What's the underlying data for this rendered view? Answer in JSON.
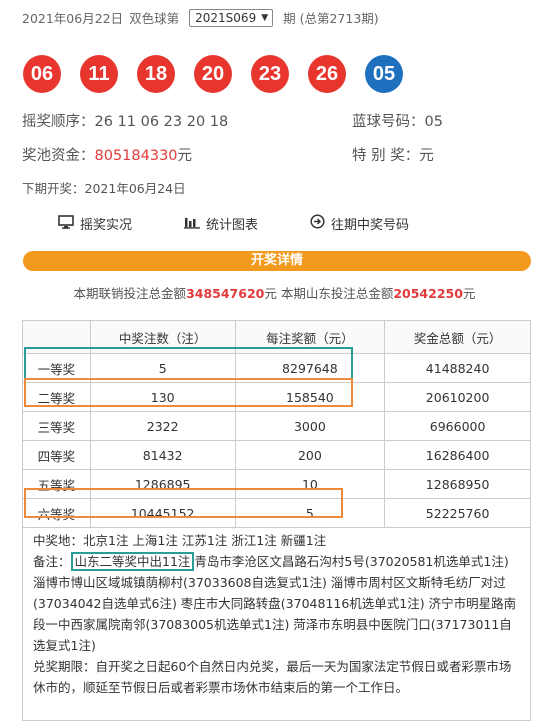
{
  "header": {
    "date": "2021年06月22日",
    "game": "双色球第",
    "issue_value": "2021S069",
    "suffix": "期 (总第2713期)"
  },
  "balls": [
    {
      "num": "06",
      "color": "#e8362f"
    },
    {
      "num": "11",
      "color": "#e8362f"
    },
    {
      "num": "18",
      "color": "#e8362f"
    },
    {
      "num": "20",
      "color": "#e8362f"
    },
    {
      "num": "23",
      "color": "#e8362f"
    },
    {
      "num": "26",
      "color": "#e8362f"
    },
    {
      "num": "05",
      "color": "#1f6fbf"
    }
  ],
  "info": {
    "order_label": "摇奖顺序：",
    "order_value": "26 11 06 23 20 18",
    "blue_label": "蓝球号码：",
    "blue_value": "05",
    "pool_label": "奖池资金：",
    "pool_value": "805184330",
    "pool_unit": "元",
    "special_label": "特 别 奖：",
    "special_value": "元",
    "next_label": "下期开奖：",
    "next_value": "2021年06月24日"
  },
  "links": {
    "live": "摇奖实况",
    "stats": "统计图表",
    "history": "往期中奖号码"
  },
  "detail_bar": "开奖详情",
  "sales": {
    "p1": "本期联销投注总金额",
    "v1": "348547620",
    "u1": "元 本期山东投注总金额",
    "v2": "20542250",
    "u2": "元"
  },
  "table": {
    "headers": [
      "",
      "中奖注数（注）",
      "每注奖额（元）",
      "奖金总额（元）"
    ],
    "rows": [
      [
        "一等奖",
        "5",
        "8297648",
        "41488240"
      ],
      [
        "二等奖",
        "130",
        "158540",
        "20610200"
      ],
      [
        "三等奖",
        "2322",
        "3000",
        "6966000"
      ],
      [
        "四等奖",
        "81432",
        "200",
        "16286400"
      ],
      [
        "五等奖",
        "1286895",
        "10",
        "12868950"
      ],
      [
        "六等奖",
        "10445152",
        "5",
        "52225760"
      ]
    ]
  },
  "notes": {
    "places": "中奖地：北京1注 上海1注 江苏1注 浙江1注 新疆1注",
    "remark_label": "备注：",
    "remark_highlight": "山东二等奖中出11注",
    "remark_text": "青岛市李沧区文昌路石沟村5号(37020581机选单式1注) 淄博市博山区域城镇荫柳村(37033608自选复式1注) 淄博市周村区文斯特毛纺厂对过(37034042自选单式6注) 枣庄市大同路转盘(37048116机选单式1注) 济宁市明星路南段一中西家属院南邻(37083005机选单式1注) 菏泽市东明县中医院门口(37173011自选复式1注)",
    "deadline": "兑奖期限：自开奖之日起60个自然日内兑奖，最后一天为国家法定节假日或者彩票市场休市的，顺延至节假日后或者彩票市场休市结束后的第一个工作日。"
  }
}
